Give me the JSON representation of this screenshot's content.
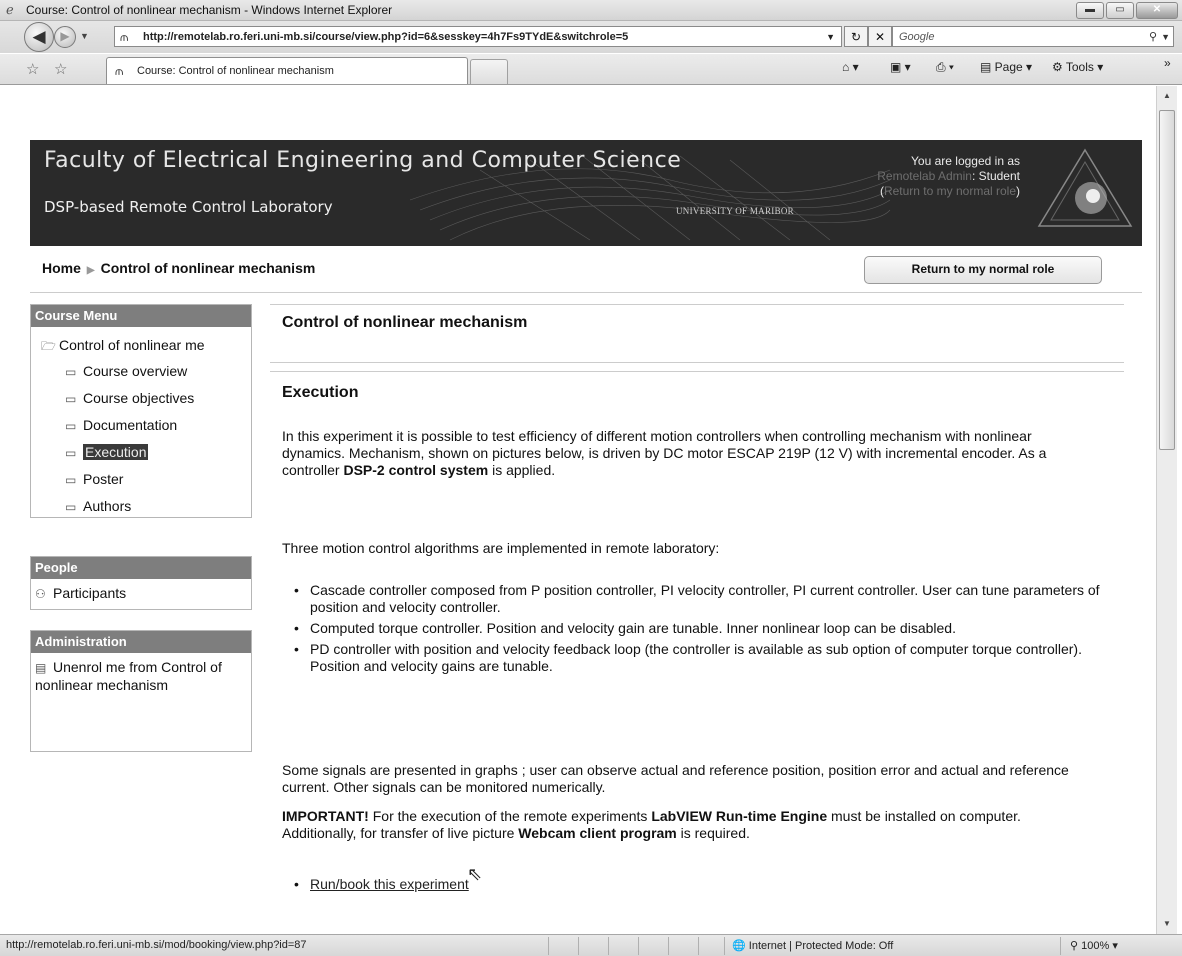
{
  "window": {
    "title": "Course: Control of nonlinear mechanism - Windows Internet Explorer",
    "min_label": "▬",
    "max_label": "▭",
    "close_label": "✕"
  },
  "address_bar": {
    "url": "http://remotelab.ro.feri.uni-mb.si/course/view.php?id=6&sesskey=4h7Fs9TYdE&switchrole=5",
    "search_placeholder": "Google"
  },
  "tab": {
    "title": "Course: Control of nonlinear mechanism"
  },
  "command_bar": {
    "page_label": "Page",
    "tools_label": "Tools"
  },
  "banner": {
    "faculty": "Faculty of Electrical Engineering and Computer Science",
    "lab": "DSP-based Remote Control Laboratory",
    "university": "UNIVERSITY OF MARIBOR",
    "logged_in_line1": "You are logged in as",
    "logged_user": "Remotelab Admin",
    "logged_role": ": Student",
    "return_link": "Return to my normal role"
  },
  "breadcrumb": {
    "home": "Home",
    "current": "Control of nonlinear mechanism"
  },
  "role_button": "Return to my normal role",
  "course_menu": {
    "header": "Course Menu",
    "root": "Control of nonlinear me",
    "items": [
      "Course overview",
      "Course objectives",
      "Documentation",
      "Execution",
      "Poster",
      "Authors"
    ]
  },
  "people": {
    "header": "People",
    "participants": "Participants"
  },
  "administration": {
    "header": "Administration",
    "unenrol": "Unenrol me from Control of nonlinear mechanism"
  },
  "main": {
    "course_title": "Control of nonlinear mechanism",
    "section_title": "Execution",
    "intro_a": "In this experiment it is possible to test efficiency of different motion controllers when controlling mechanism with nonlinear dynamics. Mechanism, shown on pictures below, is driven by DC motor ESCAP 219P (12 V) with incremental encoder. As a controller ",
    "intro_bold": "DSP-2 control system",
    "intro_b": " is applied.",
    "algorithms_intro": "Three motion control algorithms are implemented in remote laboratory:",
    "algorithms": [
      "Cascade controller composed from P position controller, PI velocity controller, PI current controller. User can tune parameters of position and velocity controller.",
      "Computed torque controller. Position and velocity gain are tunable. Inner nonlinear loop can be disabled.",
      "PD controller with position and velocity feedback loop (the controller is available as sub option of computer torque controller). Position and velocity gains are tunable."
    ],
    "signals": "Some signals are presented in graphs ; user can observe actual and reference position, position error and actual and reference current. Other signals can be monitored numerically.",
    "important_label": "IMPORTANT!",
    "important_a": " For the execution of the remote experiments ",
    "important_b1": "LabVIEW Run-time Engine",
    "important_c": " must be installed on computer. Additionally, for transfer of live picture ",
    "important_b2": "Webcam client program",
    "important_d": " is required.",
    "run_link": "Run/book this experiment"
  },
  "status_bar": {
    "url": "http://remotelab.ro.feri.uni-mb.si/mod/booking/view.php?id=87",
    "zone": "Internet | Protected Mode: Off",
    "zoom": "100%"
  }
}
